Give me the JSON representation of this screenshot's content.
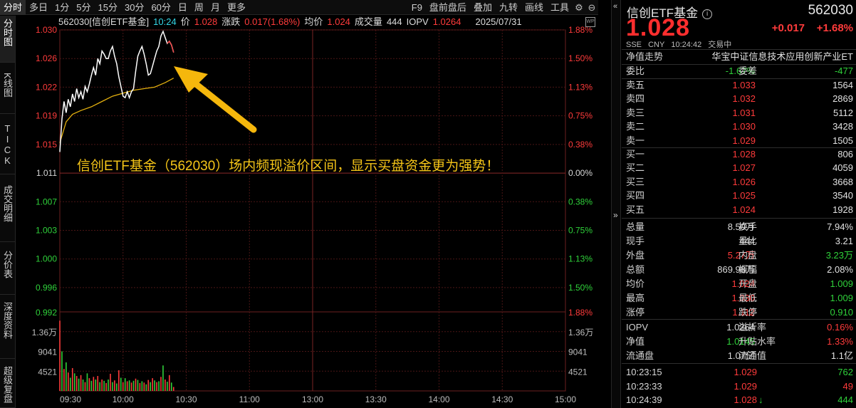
{
  "toolbar": {
    "tabs": [
      "分时",
      "多日",
      "1分",
      "5分",
      "15分",
      "30分",
      "60分",
      "日",
      "周",
      "月",
      "更多"
    ],
    "right_items": [
      "F9",
      "盘前盘后",
      "叠加",
      "九转",
      "画线",
      "工具"
    ],
    "icons": [
      "gear-icon",
      "minimize-icon"
    ]
  },
  "left_tabs": [
    {
      "label": "分时图"
    },
    {
      "label": "K线图"
    },
    {
      "label": "TICK"
    },
    {
      "label": "成交明细"
    },
    {
      "label": "分价表"
    },
    {
      "label": "深度资料"
    },
    {
      "label": "超级复盘"
    }
  ],
  "info_bar": {
    "code_name": "562030[信创ETF基金]",
    "time": "10:24",
    "price_label": "价",
    "price": "1.028",
    "change_label": "涨跌",
    "change": "0.017(1.68%)",
    "avg_label": "均价",
    "avg": "1.024",
    "vol_label": "成交量",
    "vol": "444",
    "iopv_label": "IOPV",
    "iopv": "1.0264",
    "date": "2025/07/31",
    "badge": "WP"
  },
  "annotation": "信创ETF基金（562030）场内频现溢价区间，显示买盘资金更为强势！",
  "chart_data": {
    "type": "line",
    "price_axis": {
      "min": 0.992,
      "max": 1.03,
      "base": 1.011,
      "left_ticks": [
        "1.030",
        "1.026",
        "1.022",
        "1.019",
        "1.015",
        "1.011",
        "1.007",
        "1.003",
        "1.000",
        "0.996"
      ],
      "right_ticks": [
        "1.88%",
        "1.50%",
        "1.13%",
        "0.75%",
        "0.38%",
        "0.00%",
        "0.38%",
        "0.75%",
        "1.13%",
        "1.50%"
      ]
    },
    "volume_axis": {
      "left_ticks": [
        "0.992",
        "1.36万",
        "9041",
        "4521"
      ],
      "right_ticks": [
        "1.88%",
        "1.36万",
        "9041",
        "4521"
      ],
      "max": 18000
    },
    "x_ticks": [
      "09:30",
      "10:00",
      "10:30",
      "11:00",
      "13:00",
      "13:30",
      "14:00",
      "14:30",
      "15:00"
    ],
    "price_series": [
      [
        0,
        1.0138
      ],
      [
        1,
        1.0182
      ],
      [
        2,
        1.0205
      ],
      [
        3,
        1.019
      ],
      [
        4,
        1.0208
      ],
      [
        5,
        1.0198
      ],
      [
        6,
        1.0215
      ],
      [
        7,
        1.0205
      ],
      [
        8,
        1.0222
      ],
      [
        9,
        1.021
      ],
      [
        10,
        1.0218
      ],
      [
        11,
        1.0208
      ],
      [
        12,
        1.0225
      ],
      [
        13,
        1.0218
      ],
      [
        14,
        1.0228
      ],
      [
        15,
        1.024
      ],
      [
        16,
        1.025
      ],
      [
        17,
        1.024
      ],
      [
        18,
        1.0262
      ],
      [
        19,
        1.0255
      ],
      [
        20,
        1.0272
      ],
      [
        21,
        1.0268
      ],
      [
        22,
        1.0262
      ],
      [
        23,
        1.0262
      ],
      [
        24,
        1.0272
      ],
      [
        25,
        1.0278
      ],
      [
        26,
        1.0265
      ],
      [
        27,
        1.0255
      ],
      [
        28,
        1.0238
      ],
      [
        29,
        1.0225
      ],
      [
        30,
        1.0212
      ],
      [
        31,
        1.021
      ],
      [
        32,
        1.0218
      ],
      [
        33,
        1.021
      ],
      [
        34,
        1.0218
      ],
      [
        35,
        1.0222
      ],
      [
        36,
        1.0245
      ],
      [
        37,
        1.0265
      ],
      [
        38,
        1.0272
      ],
      [
        39,
        1.0278
      ],
      [
        40,
        1.0268
      ],
      [
        41,
        1.0255
      ],
      [
        42,
        1.024
      ],
      [
        43,
        1.0242
      ],
      [
        44,
        1.0252
      ],
      [
        45,
        1.0262
      ],
      [
        46,
        1.0272
      ],
      [
        47,
        1.0278
      ],
      [
        48,
        1.0292
      ],
      [
        49,
        1.0298
      ],
      [
        50,
        1.029
      ],
      [
        51,
        1.0282
      ],
      [
        52,
        1.0285
      ],
      [
        53,
        1.028
      ],
      [
        54,
        1.027
      ]
    ],
    "avg_series": [
      [
        0,
        1.015
      ],
      [
        3,
        1.0178
      ],
      [
        6,
        1.0188
      ],
      [
        10,
        1.0193
      ],
      [
        15,
        1.0198
      ],
      [
        20,
        1.0205
      ],
      [
        25,
        1.0212
      ],
      [
        30,
        1.0216
      ],
      [
        35,
        1.022
      ],
      [
        40,
        1.0222
      ],
      [
        45,
        1.0224
      ],
      [
        50,
        1.023
      ],
      [
        54,
        1.0236
      ]
    ],
    "volume_series": [
      16000,
      9000,
      5000,
      6500,
      4200,
      3000,
      5200,
      4000,
      3400,
      2800,
      3600,
      2600,
      2000,
      4000,
      2900,
      2300,
      3200,
      2600,
      3400,
      2000,
      2600,
      2300,
      1800,
      2600,
      3900,
      2000,
      2400,
      1700,
      4700,
      3000,
      2000,
      2900,
      2200,
      2400,
      1900,
      2300,
      2800,
      2500,
      1800,
      2200,
      1900,
      1500,
      2500,
      2000,
      2900,
      2400,
      2000,
      2200,
      3200,
      5800,
      2600,
      2100,
      3600,
      1900,
      900
    ],
    "volume_colors": "alternating-red-green"
  },
  "panel": {
    "title": "信创ETF基金",
    "code": "562030",
    "price": "1.028",
    "change": "+0.017",
    "pct": "+1.68%",
    "meta": [
      "SSE",
      "CNY",
      "10:24:42",
      "交易中"
    ],
    "nav_label": "净值走势",
    "index_name": "华宝中证信息技术应用创新产业ET",
    "wei_bi_label": "委比",
    "wei_bi": "-1.67%",
    "wei_cha_label": "委差",
    "wei_cha": "-477",
    "asks": [
      {
        "label": "卖五",
        "price": "1.033",
        "vol": "1564"
      },
      {
        "label": "卖四",
        "price": "1.032",
        "vol": "2869"
      },
      {
        "label": "卖三",
        "price": "1.031",
        "vol": "5112"
      },
      {
        "label": "卖二",
        "price": "1.030",
        "vol": "3428"
      },
      {
        "label": "卖一",
        "price": "1.029",
        "vol": "1505"
      }
    ],
    "bids": [
      {
        "label": "买一",
        "price": "1.028",
        "vol": "806"
      },
      {
        "label": "买二",
        "price": "1.027",
        "vol": "4059"
      },
      {
        "label": "买三",
        "price": "1.026",
        "vol": "3668"
      },
      {
        "label": "买四",
        "price": "1.025",
        "vol": "3540"
      },
      {
        "label": "买五",
        "price": "1.024",
        "vol": "1928"
      }
    ],
    "stats": [
      {
        "l1": "总量",
        "v1": "8.50万",
        "c1": "white",
        "l2": "换手",
        "v2": "7.94%",
        "c2": "white"
      },
      {
        "l1": "现手",
        "v1": "444",
        "c1": "white",
        "l2": "量比",
        "v2": "3.21",
        "c2": "white"
      },
      {
        "l1": "外盘",
        "v1": "5.27万",
        "c1": "red",
        "l2": "内盘",
        "v2": "3.23万",
        "c2": "green"
      },
      {
        "l1": "总额",
        "v1": "869.98万",
        "c1": "white",
        "l2": "振幅",
        "v2": "2.08%",
        "c2": "white"
      },
      {
        "l1": "均价",
        "v1": "1.024",
        "c1": "red",
        "l2": "开盘",
        "v2": "1.009",
        "c2": "green"
      },
      {
        "l1": "最高",
        "v1": "1.030",
        "c1": "red",
        "l2": "最低",
        "v2": "1.009",
        "c2": "green"
      },
      {
        "l1": "涨停",
        "v1": "1.112",
        "c1": "red",
        "l2": "跌停",
        "v2": "0.910",
        "c2": "green"
      }
    ],
    "etf_stats": [
      {
        "l1": "IOPV",
        "v1": "1.0264",
        "c1": "white",
        "l2": "溢折率",
        "v2": "0.16%",
        "c2": "red"
      },
      {
        "l1": "净值",
        "v1": "1.0145",
        "c1": "green",
        "l2": "升贴水率",
        "v2": "1.33%",
        "c2": "red"
      },
      {
        "l1": "流通盘",
        "v1": "1.07亿",
        "c1": "white",
        "l2": "流通值",
        "v2": "1.1亿",
        "c2": "white"
      }
    ],
    "ticks": [
      {
        "time": "10:23:15",
        "price": "1.029",
        "vol": "762",
        "vc": "green"
      },
      {
        "time": "10:23:33",
        "price": "1.029",
        "vol": "49",
        "vc": "red"
      },
      {
        "time": "10:24:39",
        "price": "1.028",
        "vol": "444",
        "vc": "green",
        "arrow": "↓"
      }
    ]
  },
  "colors": {
    "up": "#ff3b3b",
    "down": "#2fd13a",
    "price_line": "#ffffff",
    "avg_line": "#e3b00f",
    "grid": "#5a1a1a",
    "annotation": "#f5c518",
    "arrow": "#f5b70c"
  }
}
